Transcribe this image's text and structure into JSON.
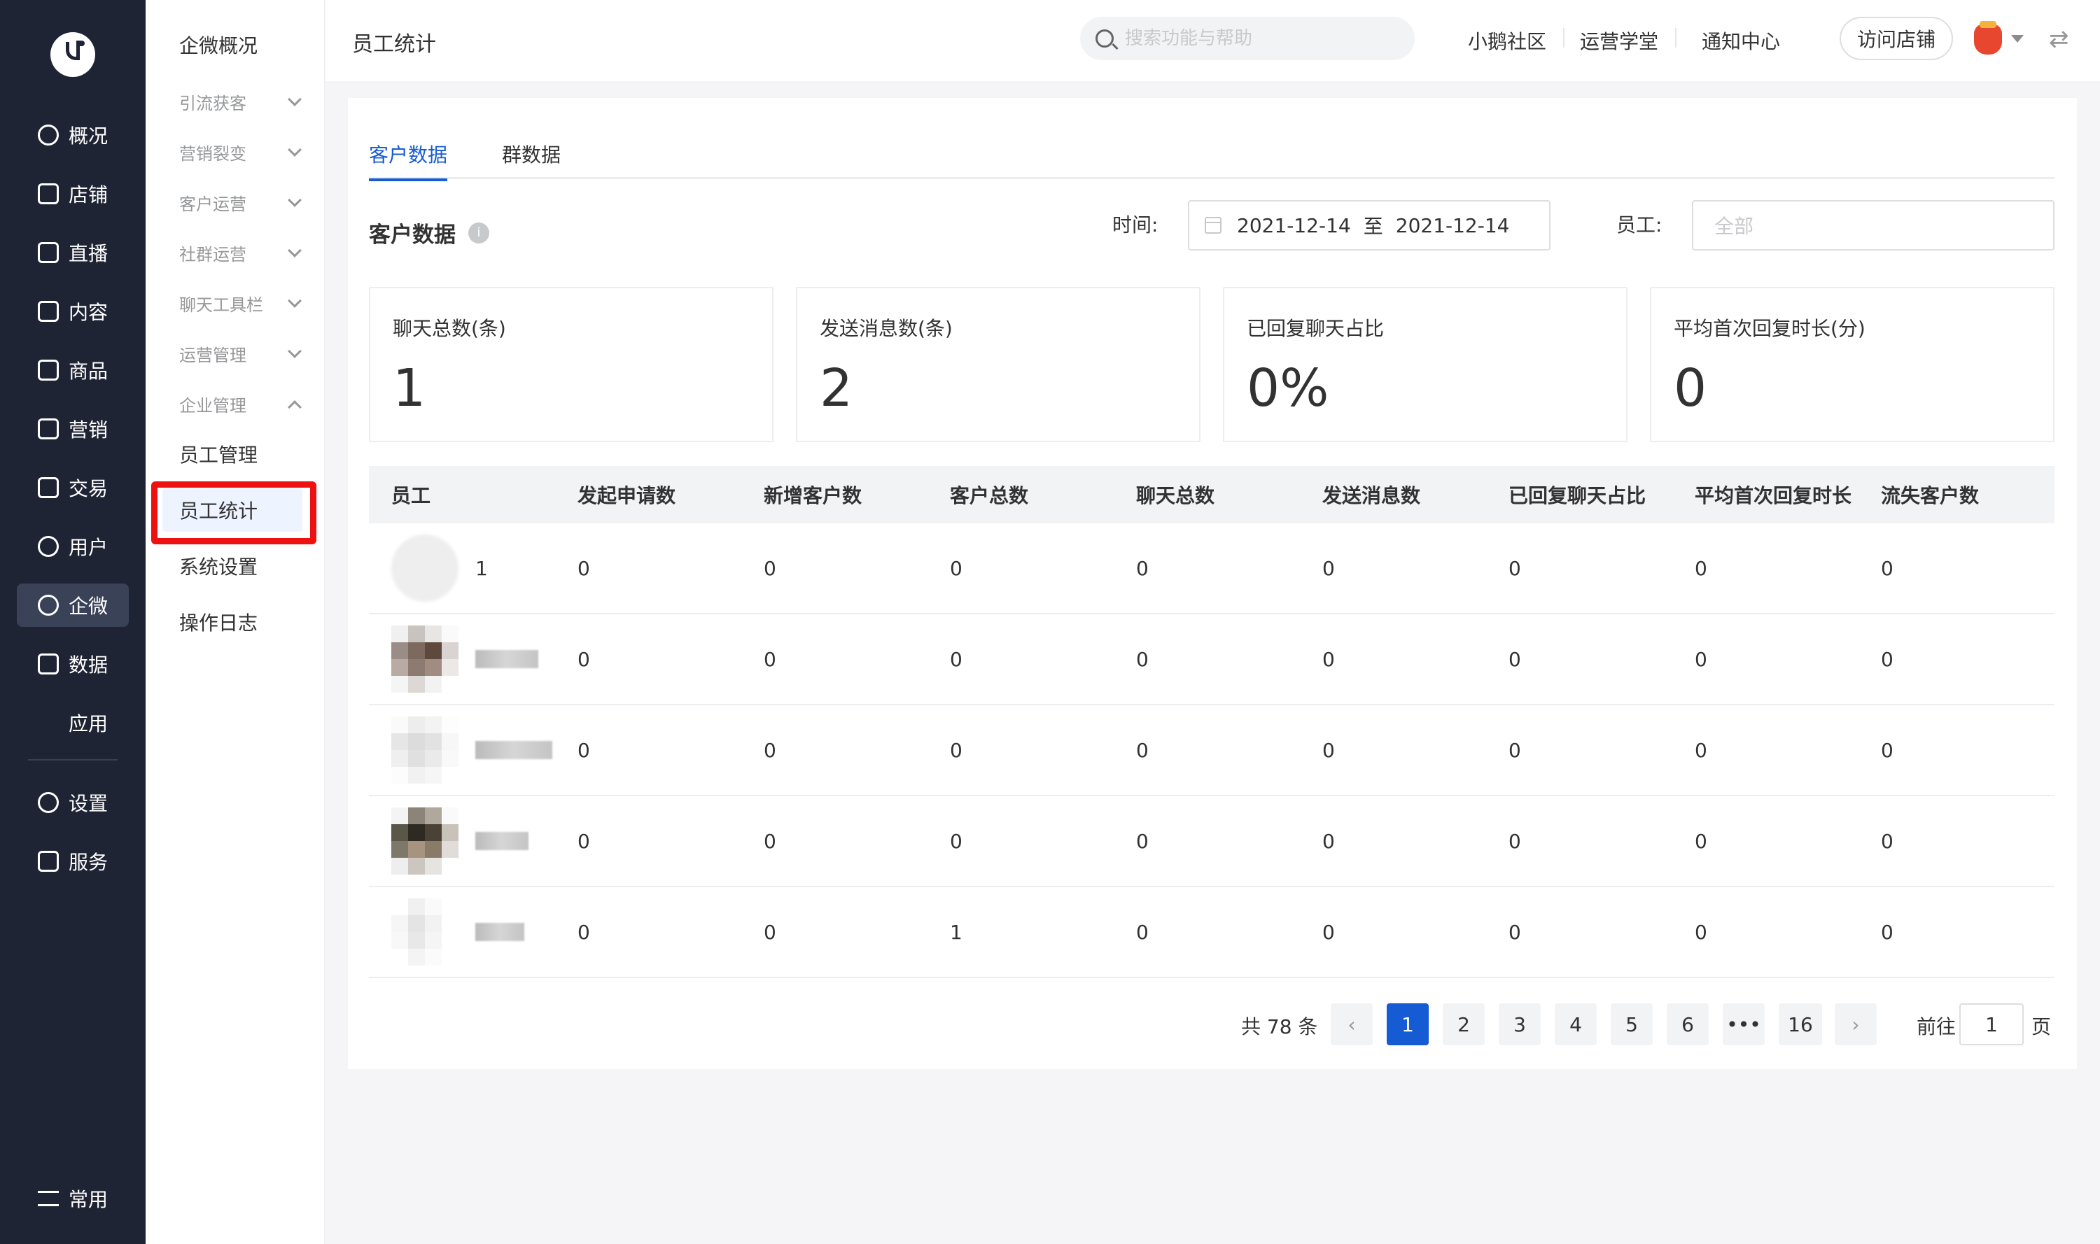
{
  "rail": {
    "items": [
      {
        "label": "概况",
        "icon": "pie-chart-icon"
      },
      {
        "label": "店铺",
        "icon": "store-icon"
      },
      {
        "label": "直播",
        "icon": "live-camera-icon"
      },
      {
        "label": "内容",
        "icon": "document-icon"
      },
      {
        "label": "商品",
        "icon": "product-box-icon"
      },
      {
        "label": "营销",
        "icon": "megaphone-icon"
      },
      {
        "label": "交易",
        "icon": "exchange-icon"
      },
      {
        "label": "用户",
        "icon": "user-icon"
      },
      {
        "label": "企微",
        "icon": "chat-bubble-icon",
        "active": true
      },
      {
        "label": "数据",
        "icon": "chart-icon"
      },
      {
        "label": "应用",
        "icon": "apps-grid-icon"
      },
      {
        "label": "设置",
        "icon": "gear-icon"
      },
      {
        "label": "服务",
        "icon": "service-hand-icon"
      },
      {
        "label": "常用",
        "icon": "list-menu-icon"
      }
    ]
  },
  "submenu": {
    "title": "企微概况",
    "groups": [
      {
        "label": "引流获客"
      },
      {
        "label": "营销裂变"
      },
      {
        "label": "客户运营"
      },
      {
        "label": "社群运营"
      },
      {
        "label": "聊天工具栏"
      },
      {
        "label": "运营管理"
      },
      {
        "label": "企业管理"
      }
    ],
    "items": [
      {
        "label": "员工管理"
      },
      {
        "label": "员工统计"
      },
      {
        "label": "系统设置"
      },
      {
        "label": "操作日志"
      }
    ]
  },
  "header": {
    "title": "员工统计",
    "search_placeholder": "搜索功能与帮助",
    "links": [
      "小鹅社区",
      "运营学堂",
      "通知中心"
    ],
    "visit_store": "访问店铺"
  },
  "tabs": [
    "客户数据",
    "群数据"
  ],
  "section": {
    "title": "客户数据",
    "info": "i",
    "time_label": "时间:",
    "date_start": "2021-12-14",
    "date_sep": "至",
    "date_end": "2021-12-14",
    "employee_label": "员工:",
    "employee_placeholder": "全部"
  },
  "stats": [
    {
      "label": "聊天总数(条)",
      "value": "1"
    },
    {
      "label": "发送消息数(条)",
      "value": "2"
    },
    {
      "label": "已回复聊天占比",
      "value": "0%"
    },
    {
      "label": "平均首次回复时长(分)",
      "value": "0"
    }
  ],
  "table": {
    "headers": [
      "员工",
      "发起申请数",
      "新增客户数",
      "客户总数",
      "聊天总数",
      "发送消息数",
      "已回复聊天占比",
      "平均首次回复时长",
      "流失客户数"
    ],
    "rows": [
      {
        "name": "1",
        "values": [
          "0",
          "0",
          "0",
          "0",
          "0",
          "0",
          "0",
          "0"
        ]
      },
      {
        "name": "",
        "values": [
          "0",
          "0",
          "0",
          "0",
          "0",
          "0",
          "0",
          "0"
        ]
      },
      {
        "name": "",
        "values": [
          "0",
          "0",
          "0",
          "0",
          "0",
          "0",
          "0",
          "0"
        ]
      },
      {
        "name": "",
        "values": [
          "0",
          "0",
          "0",
          "0",
          "0",
          "0",
          "0",
          "0"
        ]
      },
      {
        "name": "",
        "values": [
          "0",
          "0",
          "1",
          "0",
          "0",
          "0",
          "0",
          "0"
        ]
      }
    ]
  },
  "pager": {
    "total": "共 78 条",
    "pages": [
      "1",
      "2",
      "3",
      "4",
      "5",
      "6",
      "•••",
      "16"
    ],
    "prev": "‹",
    "next": "›",
    "goto_label": "前往",
    "goto_value": "1",
    "goto_suffix": "页"
  },
  "colors": {
    "accent": "#155bd4",
    "rail_bg": "#1f2434",
    "highlight_box": "#ee1111"
  }
}
